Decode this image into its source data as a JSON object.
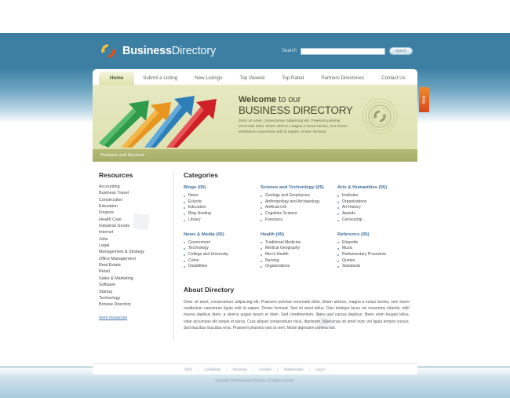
{
  "site": {
    "brand_bold": "Business",
    "brand_light": "Directory",
    "logo_icon": "refresh-circle-logo"
  },
  "search": {
    "label": "Search",
    "value": "",
    "placeholder": "",
    "button_label": "search"
  },
  "nav": {
    "items": [
      {
        "label": "Home",
        "active": true
      },
      {
        "label": "Submit a Listing",
        "active": false
      },
      {
        "label": "New Listings",
        "active": false
      },
      {
        "label": "Top Viewed",
        "active": false
      },
      {
        "label": "Top Rated",
        "active": false
      },
      {
        "label": "Partners Directories",
        "active": false
      },
      {
        "label": "Contact Us",
        "active": false
      }
    ]
  },
  "hero": {
    "welcome_bold": "Welcome",
    "welcome_rest": " to our",
    "title": "BUSINESS DIRECTORY",
    "body": "Dolor sit amet, consectetuer adipiscing elit. Praesent pulvinar venenatis dolor. Etiam ultrices, magna a luctus lacinia, sem lorem vestibulum caectetuer velit id sapien. Donec fermeat.",
    "emblem_icon": "refresh-circle-emblem",
    "arrows_icon": "3d-arrows-graphic"
  },
  "products_bar": {
    "label": "Products and Services"
  },
  "rss": {
    "label": "RSS"
  },
  "sidebar": {
    "title": "Resources",
    "items": [
      {
        "label": "Accounting"
      },
      {
        "label": "Business Travel"
      },
      {
        "label": "Construction"
      },
      {
        "label": "Education"
      },
      {
        "label": "Finance"
      },
      {
        "label": "Health Care"
      },
      {
        "label": "Industrial Goods"
      },
      {
        "label": "Internet"
      },
      {
        "label": "Jobs"
      },
      {
        "label": "Legal"
      },
      {
        "label": "Management & Strategy"
      },
      {
        "label": "Office Management"
      },
      {
        "label": "Real Estate"
      },
      {
        "label": "Retail"
      },
      {
        "label": "Sales & Marketing"
      },
      {
        "label": "Software"
      },
      {
        "label": "Startup"
      },
      {
        "label": "Technology"
      },
      {
        "label": "Browse Directory"
      }
    ],
    "more_label": "more resources"
  },
  "categories": {
    "title": "Categories",
    "groups": [
      {
        "heading": "Blogs (05)",
        "items": [
          "News",
          "Eclectic",
          "Education",
          "Blog Hosting",
          "Library"
        ]
      },
      {
        "heading": "Science and Technology (05)",
        "items": [
          "Geology and Geophysics",
          "Anthropology and Archaeology",
          "Artificial Life",
          "Cognitive Science",
          "Forensics"
        ]
      },
      {
        "heading": "Arts & Humanities (05)",
        "items": [
          "Institutes",
          "Organizations",
          "Art History",
          "Awards",
          "Censorship"
        ]
      },
      {
        "heading": "News & Media (05)",
        "items": [
          "Government",
          "Technology",
          "College and University",
          "Crime",
          "Disabilities"
        ]
      },
      {
        "heading": "Health (05)",
        "items": [
          "Traditional Medicine",
          "Medical Geography",
          "Men's Health",
          "Nursing",
          "Organizations"
        ]
      },
      {
        "heading": "Reference (05)",
        "items": [
          "Etiquette",
          "Music",
          "Parliamentary Procedure",
          "Quotes",
          "Standards"
        ]
      }
    ]
  },
  "about": {
    "title": "About Directory",
    "body": "Dolor sit amet, consectetuer adipiscing elit. Praesent pulvinar venenatis dolor. Etiam ultrices, magna a luctus lacinia, sem lorem vestibulum caectetuer ligula velit id sapien. Donec fermeat. Sed sit amet tellus. Duis tristique lacus vel nonummy lobortis, nibh massa dapibus diam, a viverra augue ipsum et diam. Sed condimentum, libero sed cursus dapibus, libero enim feugiat tellus, vitae accumsan elit neque et purus. Cras aliquet consectetuer risus, dignissim. Maecenas sit amet nunc vel ligula tempor cursus. Sed faucibus faucibus eros. Praesent pharetra wisi ut sem. Morbi dignissim pulvina nisl."
  },
  "footer": {
    "links": [
      "RSS",
      "Contribute",
      "Revenue",
      "Contact",
      "Testimonials",
      "Log In"
    ],
    "separator": "|",
    "copyright": "Copyright 2009 Business Directory. All rights reserved."
  },
  "colors": {
    "header_blue": "#3c7fa3",
    "hero_olive": "#e6e9c2",
    "products_bar": "#b6bb78",
    "rss_orange": "#e0601f",
    "link_blue": "#3f6f9e"
  }
}
